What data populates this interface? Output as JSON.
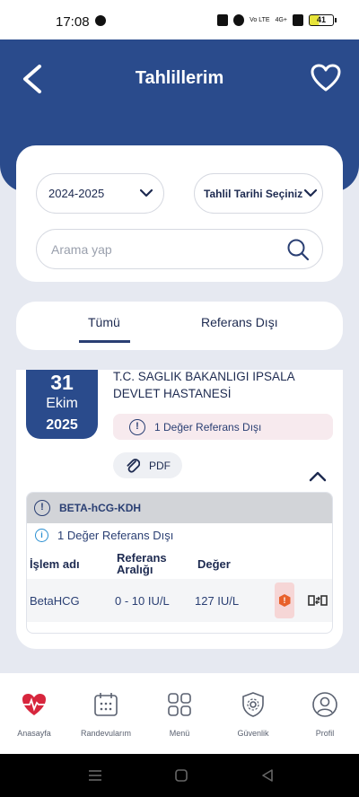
{
  "status_bar": {
    "time": "17:08",
    "network_label": "Vo LTE",
    "signal_label": "4G+",
    "battery": "41"
  },
  "header": {
    "title": "Tahlillerim"
  },
  "filters": {
    "year_value": "2024-2025",
    "date_select_label": "Tahlil Tarihi Seçiniz",
    "search_placeholder": "Arama yap"
  },
  "tabs": [
    {
      "label": "Tümü",
      "active": true
    },
    {
      "label": "Referans Dışı",
      "active": false
    }
  ],
  "result": {
    "day": "31",
    "month": "Ekim",
    "year": "2025",
    "hospital_line1": "T.C. SAGLIK BAKANLIGI  IPSALA",
    "hospital_line2": "DEVLET HASTANESİ",
    "warning": "1 Değer Referans Dışı",
    "pdf_label": "PDF",
    "test": {
      "name": "BETA-hCG-KDH",
      "warning": "1 Değer Referans Dışı",
      "headers": {
        "name": "İşlem adı",
        "ref_line1": "Referans",
        "ref_line2": "Aralığı",
        "value": "Değer"
      },
      "rows": [
        {
          "name": "BetaHCG",
          "range": "0 - 10 IU/L",
          "value": "127 IU/L",
          "alert": "!"
        }
      ]
    }
  },
  "bottom_nav": [
    {
      "label": "Anasayfa",
      "icon": "heart-pulse-icon"
    },
    {
      "label": "Randevularım",
      "icon": "calendar-icon"
    },
    {
      "label": "Menü",
      "icon": "grid-icon"
    },
    {
      "label": "Güvenlik",
      "icon": "shield-gear-icon"
    },
    {
      "label": "Profil",
      "icon": "user-icon"
    }
  ],
  "colors": {
    "primary": "#2a4b8c",
    "background": "#e6e9f1",
    "alert": "#e8602a"
  }
}
